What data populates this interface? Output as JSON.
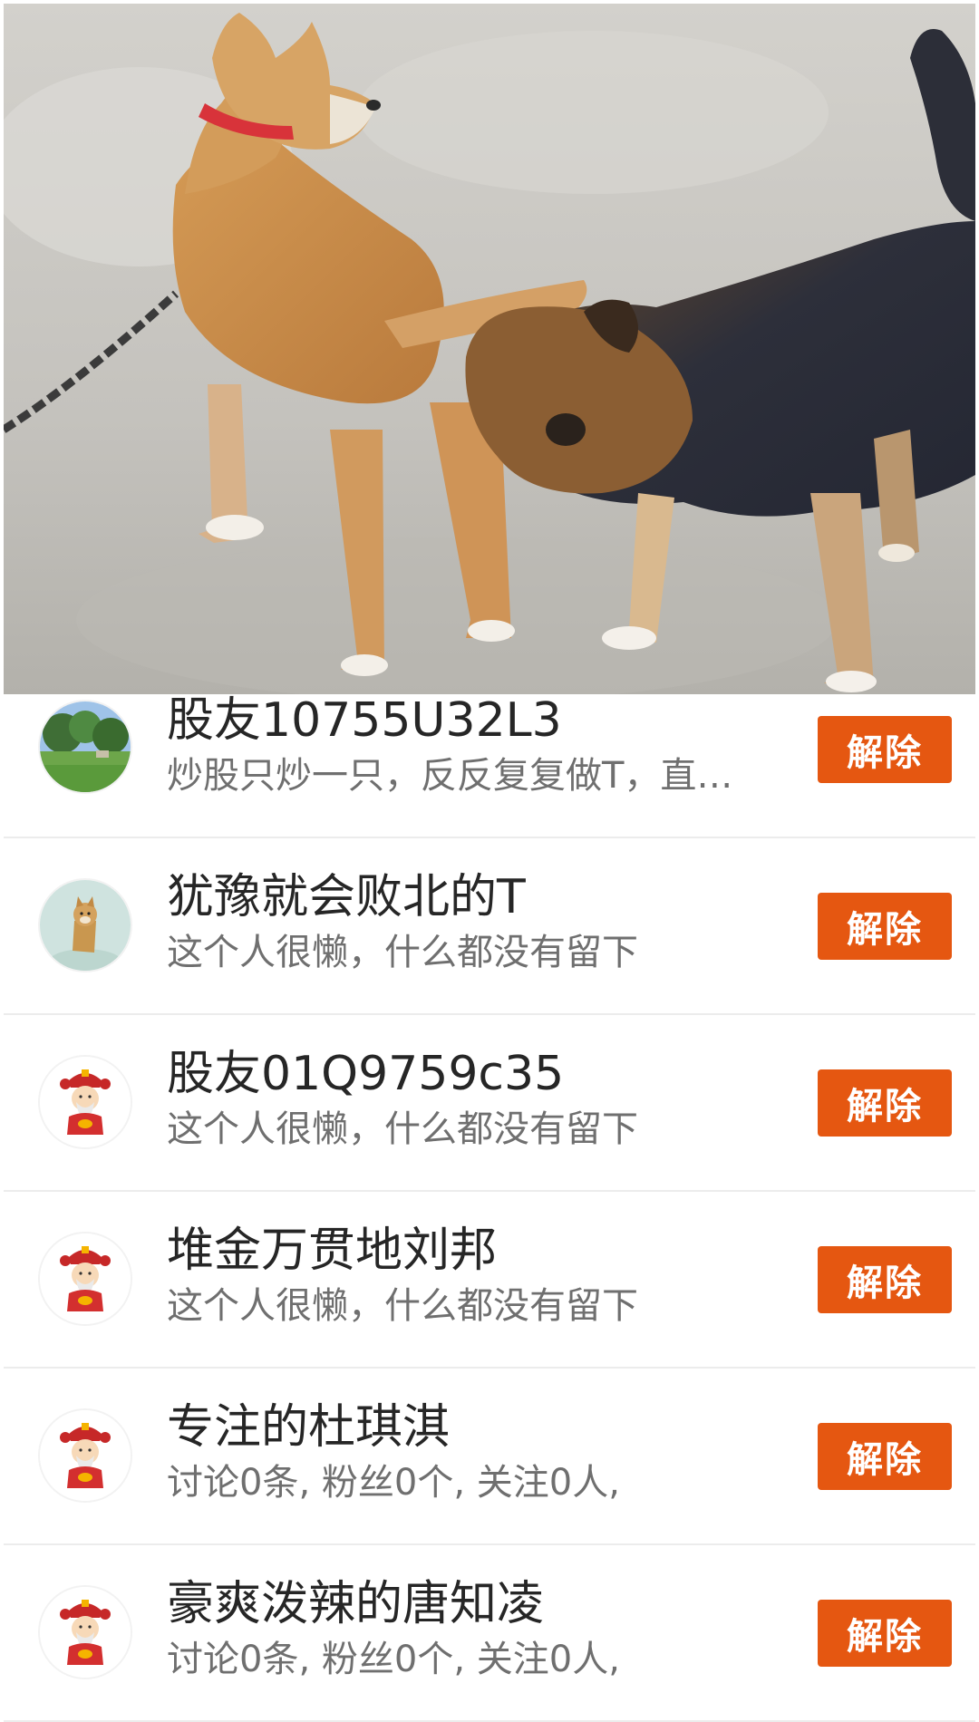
{
  "hero_image": {
    "icon": "photo-two-dogs"
  },
  "colors": {
    "button_bg": "#e55711",
    "button_text": "#ffffff",
    "name_text": "#262626",
    "desc_text": "#6f6f6f",
    "divider": "#ececec"
  },
  "users": [
    {
      "name": "股友10755U32L3",
      "desc": "炒股只炒一只，反反复复做T，直…",
      "button_label": "解除",
      "avatar_icon": "landscape-photo-avatar"
    },
    {
      "name": "犹豫就会败北的T",
      "desc": "这个人很懒，什么都没有留下",
      "button_label": "解除",
      "avatar_icon": "shiba-dog-avatar"
    },
    {
      "name": "股友01Q9759c35",
      "desc": "这个人很懒，什么都没有留下",
      "button_label": "解除",
      "avatar_icon": "fortune-god-avatar"
    },
    {
      "name": "堆金万贯地刘邦",
      "desc": "这个人很懒，什么都没有留下",
      "button_label": "解除",
      "avatar_icon": "fortune-god-avatar"
    },
    {
      "name": "专注的杜琪淇",
      "desc": "讨论0条, 粉丝0个, 关注0人,",
      "button_label": "解除",
      "avatar_icon": "fortune-god-avatar"
    },
    {
      "name": "豪爽泼辣的唐知凌",
      "desc": "讨论0条, 粉丝0个, 关注0人,",
      "button_label": "解除",
      "avatar_icon": "fortune-god-avatar"
    }
  ]
}
